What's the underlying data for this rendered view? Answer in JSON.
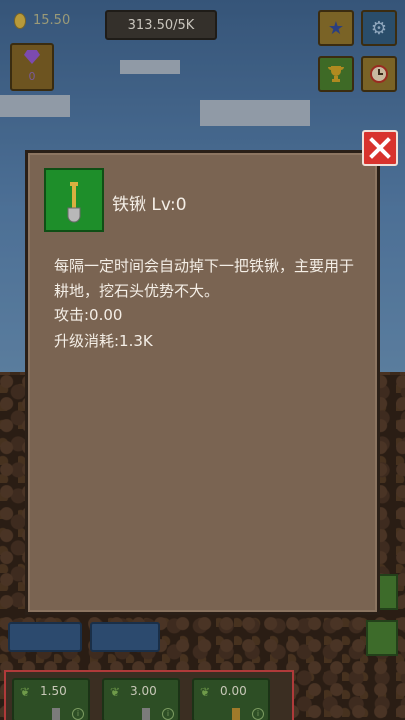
{
  "hud": {
    "coins": "15.50",
    "progress": "313.50/5K",
    "gems": "0"
  },
  "dialog": {
    "item_name": "铁锹 Lv:0",
    "description": "每隔一定时间会自动掉下一把铁锹，主要用于耕地，挖石头优势不大。",
    "attack": "攻击:0.00",
    "upgrade_cost": "升级消耗:1.3K"
  },
  "bottom": {
    "tools": [
      {
        "value": "1.50"
      },
      {
        "value": "3.00"
      },
      {
        "value": "0.00"
      }
    ]
  },
  "colors": {
    "dialog_bg": "#7a6452",
    "close_red": "#d8332d",
    "item_green": "#1e8e2a"
  },
  "icons": {
    "close": "close-icon",
    "item": "shovel-icon",
    "star": "star-icon",
    "gear": "gear-icon",
    "trophy": "trophy-icon",
    "clock": "clock-icon",
    "gem": "gem-icon",
    "coin": "coin-icon"
  }
}
